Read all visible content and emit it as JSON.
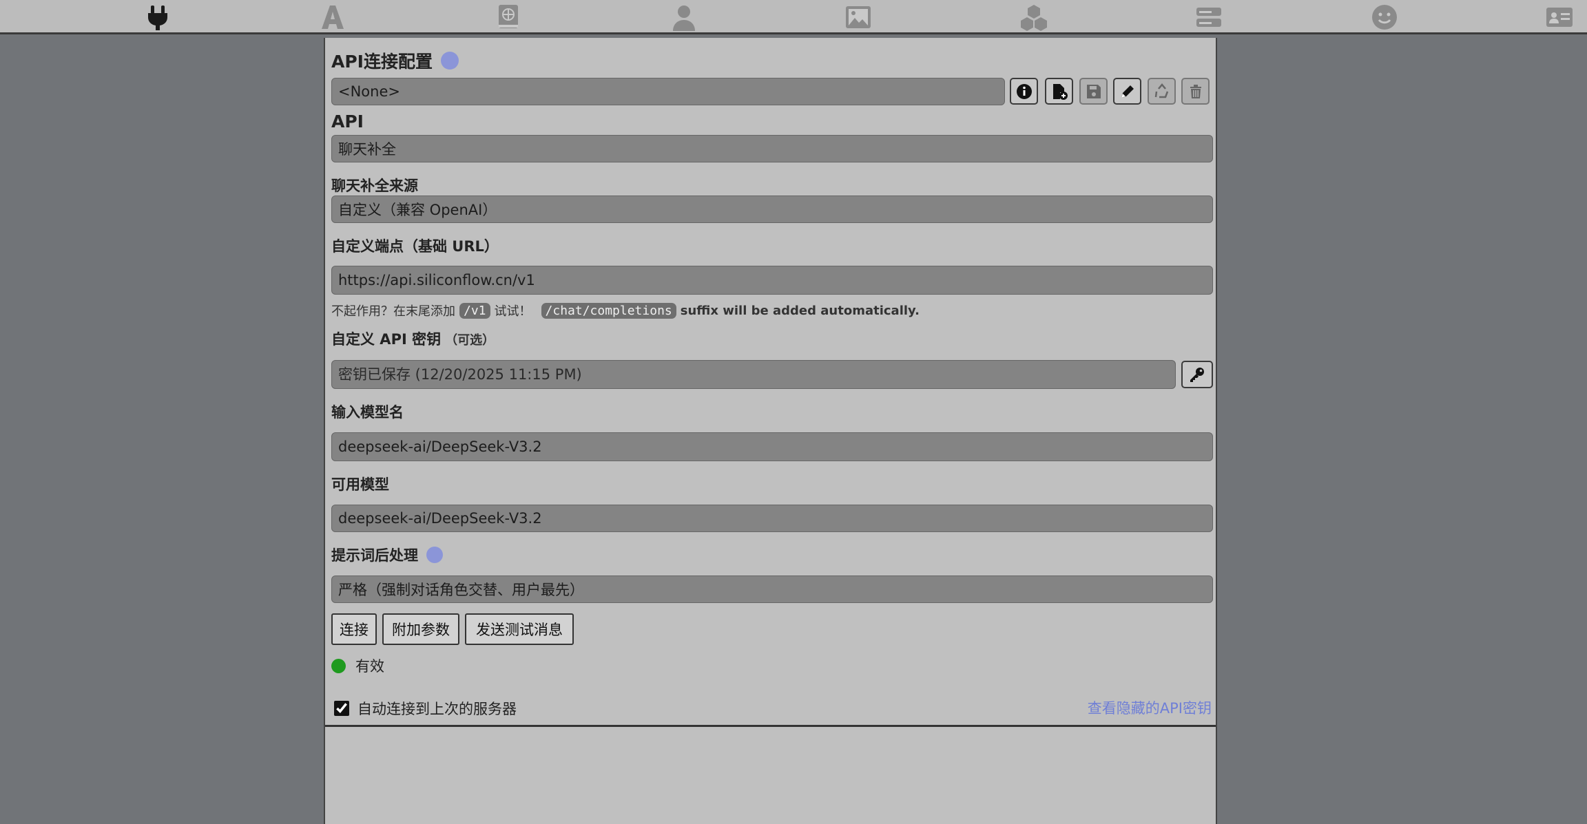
{
  "nav": {
    "icons": [
      "plug-icon",
      "font-icon",
      "book-atlas-icon",
      "user-icon",
      "image-icon",
      "cubes-icon",
      "server-icon",
      "smile-icon",
      "id-card-icon"
    ]
  },
  "api_config": {
    "title": "API连接配置",
    "profile_select_value": "<None>",
    "api_label": "API",
    "api_value": "聊天补全",
    "source_label": "聊天补全来源",
    "source_value": "自定义（兼容 OpenAI）",
    "endpoint_label": "自定义端点（基础 URL）",
    "endpoint_value": "https://api.siliconflow.cn/v1",
    "hint_prefix": "不起作用？在末尾添加",
    "hint_code1": "/v1",
    "hint_mid": "试试！",
    "hint_code2": "/chat/completions",
    "hint_suffix": "suffix will be added automatically.",
    "key_label": "自定义 API 密钥",
    "key_optional": "（可选）",
    "key_placeholder": "密钥已保存 (12/20/2025 11:15 PM)",
    "model_input_label": "输入模型名",
    "model_input_value": "deepseek-ai/DeepSeek-V3.2",
    "available_label": "可用模型",
    "available_value": "deepseek-ai/DeepSeek-V3.2",
    "postproc_label": "提示词后处理",
    "postproc_value": "严格（强制对话角色交替、用户最先）",
    "btn_connect": "连接",
    "btn_params": "附加参数",
    "btn_test": "发送测试消息",
    "status_text": "有效",
    "status_color": "#1f9a1f",
    "auto_connect_label": "自动连接到上次的服务器",
    "auto_connect_checked": true,
    "view_keys_link": "查看隐藏的API密钥",
    "link_color": "#6f7fd6"
  }
}
